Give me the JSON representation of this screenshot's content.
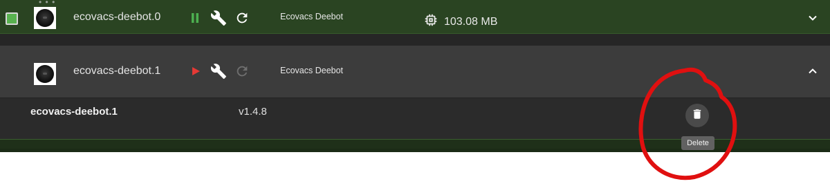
{
  "adapters": [
    {
      "name": "ecovacs-deebot.0",
      "vendor": "Ecovacs Deebot",
      "status": "running",
      "memory": "103.08 MB",
      "checked": true,
      "icons": {
        "control": "pause-icon",
        "settings": "wrench-icon",
        "restart": "refresh-icon",
        "memory": "chip-icon",
        "toggle": "chevron-down-icon"
      }
    },
    {
      "name": "ecovacs-deebot.1",
      "vendor": "Ecovacs Deebot",
      "status": "stopped",
      "checked": false,
      "icons": {
        "control": "play-icon",
        "settings": "wrench-icon",
        "restart": "refresh-icon",
        "toggle": "chevron-up-icon"
      },
      "details": {
        "instance": "ecovacs-deebot.1",
        "version": "v1.4.8",
        "delete_icon": "trash-icon",
        "delete_tooltip": "Delete"
      }
    }
  ],
  "colors": {
    "running_row": "#2a4422",
    "pause_green": "#4caf50",
    "play_red": "#e53935",
    "annotation_red": "#e01010"
  }
}
